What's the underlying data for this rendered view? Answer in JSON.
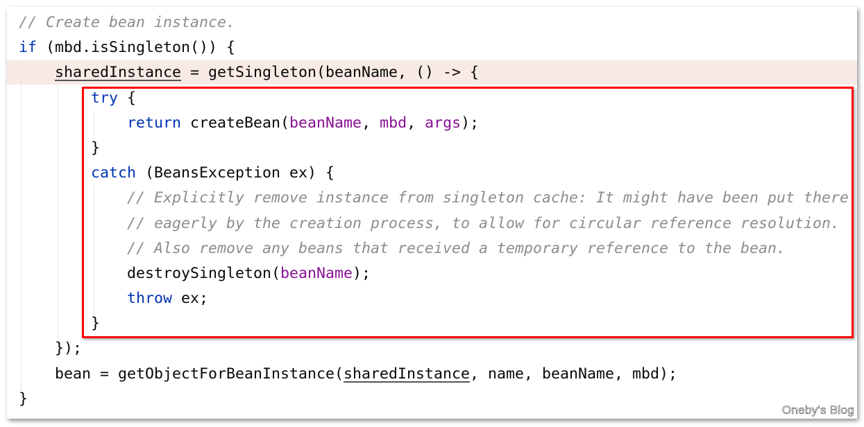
{
  "colors": {
    "keyword": "#0033b3",
    "parameter": "#871094",
    "comment": "#8c8c8c",
    "highlight_box": "#ff0000",
    "highlighted_line": "#f8eae5"
  },
  "code_lines": [
    [
      {
        "t": "cm",
        "v": "// Create bean instance."
      }
    ],
    [
      {
        "t": "kw",
        "v": "if"
      },
      {
        "t": "p",
        "v": " (mbd.isSingleton()) {"
      }
    ],
    [
      {
        "t": "p",
        "v": "    "
      },
      {
        "t": "ul",
        "v": "sharedInstance"
      },
      {
        "t": "p",
        "v": " = getSingleton(beanName, () -> {"
      }
    ],
    [
      {
        "t": "p",
        "v": "        "
      },
      {
        "t": "kw",
        "v": "try"
      },
      {
        "t": "p",
        "v": " {"
      }
    ],
    [
      {
        "t": "p",
        "v": "            "
      },
      {
        "t": "kw",
        "v": "return"
      },
      {
        "t": "p",
        "v": " createBean("
      },
      {
        "t": "param",
        "v": "beanName"
      },
      {
        "t": "p",
        "v": ", "
      },
      {
        "t": "param",
        "v": "mbd"
      },
      {
        "t": "p",
        "v": ", "
      },
      {
        "t": "param",
        "v": "args"
      },
      {
        "t": "p",
        "v": ");"
      }
    ],
    [
      {
        "t": "p",
        "v": "        }"
      }
    ],
    [
      {
        "t": "p",
        "v": "        "
      },
      {
        "t": "kw",
        "v": "catch"
      },
      {
        "t": "p",
        "v": " (BeansException ex) {"
      }
    ],
    [
      {
        "t": "p",
        "v": "            "
      },
      {
        "t": "cm",
        "v": "// Explicitly remove instance from singleton cache: It might have been put there"
      }
    ],
    [
      {
        "t": "p",
        "v": "            "
      },
      {
        "t": "cm",
        "v": "// eagerly by the creation process, to allow for circular reference resolution."
      }
    ],
    [
      {
        "t": "p",
        "v": "            "
      },
      {
        "t": "cm",
        "v": "// Also remove any beans that received a temporary reference to the bean."
      }
    ],
    [
      {
        "t": "p",
        "v": "            destroySingleton("
      },
      {
        "t": "param",
        "v": "beanName"
      },
      {
        "t": "p",
        "v": ");"
      }
    ],
    [
      {
        "t": "p",
        "v": "            "
      },
      {
        "t": "kw",
        "v": "throw"
      },
      {
        "t": "p",
        "v": " ex;"
      }
    ],
    [
      {
        "t": "p",
        "v": "        }"
      }
    ],
    [
      {
        "t": "p",
        "v": "    });"
      }
    ],
    [
      {
        "t": "p",
        "v": "    bean = getObjectForBeanInstance("
      },
      {
        "t": "ul",
        "v": "sharedInstance"
      },
      {
        "t": "p",
        "v": ", name, beanName, mbd);"
      }
    ],
    [
      {
        "t": "p",
        "v": "}"
      }
    ]
  ],
  "watermark": "Oneby's Blog"
}
